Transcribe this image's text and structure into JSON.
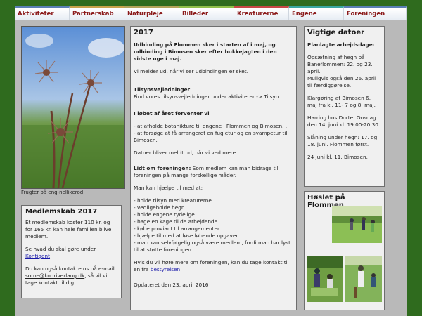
{
  "nav": {
    "tabs": [
      {
        "label": "Aktiviteter",
        "color": "#5a7fb5"
      },
      {
        "label": "Partnerskab",
        "color": "#c9a24b"
      },
      {
        "label": "Naturpleje",
        "color": "#b3a35a"
      },
      {
        "label": "Billeder",
        "color": "#8fbf4a"
      },
      {
        "label": "Kreaturerne",
        "color": "#c94747"
      },
      {
        "label": "Engene",
        "color": "#3aa6a0"
      },
      {
        "label": "Foreningen",
        "color": "#5a7fb5"
      }
    ]
  },
  "left": {
    "caption": "Frugter på eng-nellikerod",
    "membership": {
      "title": "Medlemskab 2017",
      "p1": "Et medlemskab koster 110 kr. og for 165 kr. kan hele familien blive medlem.",
      "p2_before": "Se hvad du skal gøre under",
      "p2_link": "Kontigent",
      "p3_before": "Du kan også kontakte os på e-mail",
      "p3_email": "soroe@kodriverlaug.dk",
      "p3_after": ", så vil vi tage kontakt til dig."
    }
  },
  "main": {
    "title": "2017",
    "intro_bold": "Udbinding på Flommen sker i starten af i maj, og udbinding i Bimosen sker efter bukkejagten i den sidste uge i maj.",
    "intro_note": "Vi melder ud, når vi ser udbindingen er sket.",
    "tilsyn_heading": "Tilsynsvejledninger",
    "tilsyn_text": "Find vores tilsynsvejledninger under aktiviteter -> Tilsyn.",
    "year_heading": "I løbet af året forventer vi",
    "year_items": [
      "- at afholde botanikture til engene i Flommen og Bimosen. .",
      "- at forsøge at få arrangeret en fugletur og en svampetur til Bimosen."
    ],
    "year_note": "Datoer bliver meldt ud, når vi ved mere.",
    "member_bold": "Lidt om foreningen:",
    "member_text": " Som medlem kan man bidrage til foreningen på mange forskellige måder.",
    "help_intro": "Man kan hjælpe til med at:",
    "help_items": [
      "- holde tilsyn med kreaturerne",
      "- vedligeholde hegn",
      "- holde engene rydelige",
      "- bage en kage til de arbejdende",
      "- købe proviant til arrangementer",
      "- hjælpe til med at løse løbende opgaver",
      "- man kan selvfølgelig også være medlem, fordi man har lyst til at støtte foreningen"
    ],
    "more_before": "Hvis du vil høre mere om foreningen, kan du tage kontakt til en fra",
    "more_link": "bestyrelsen",
    "more_after": ".",
    "updated": "Opdateret den 23. april 2016"
  },
  "right": {
    "dates": {
      "title": "Vigtige datoer",
      "sub": "Planlagte arbejdsdage:",
      "p1": "Opsætning af hegn på Baneflommen: 22. og 23. april.",
      "p1b": "Muligvis også den 26. april til færdiggørelse.",
      "p2": "Klargøring af Bimosen 6. maj fra kl. 11- 7 og 8. maj.",
      "p3": "Harring hos Dorte: Onsdag den 14. juni kl. 19.00-20.30.",
      "p4": "Slåning under hegn: 17. og 18. juni. Flommen først.",
      "p5": "24 juni kl. 11. Bimosen."
    },
    "hoslet": {
      "title": "Høslet på Flommen"
    }
  }
}
